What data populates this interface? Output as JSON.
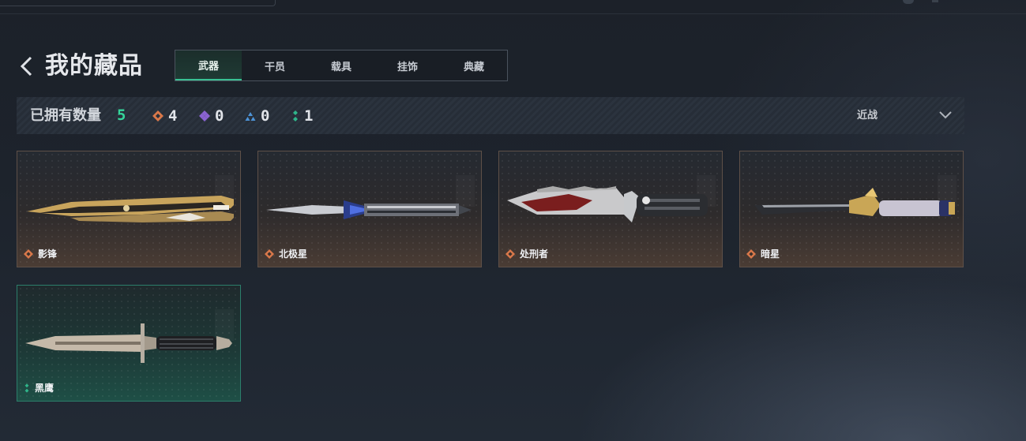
{
  "page": {
    "title": "我的藏品"
  },
  "tabs": [
    {
      "label": "武器",
      "active": true
    },
    {
      "label": "干员",
      "active": false
    },
    {
      "label": "载具",
      "active": false
    },
    {
      "label": "挂饰",
      "active": false
    },
    {
      "label": "典藏",
      "active": false
    }
  ],
  "stats": {
    "label": "已拥有数量",
    "total": "5",
    "rarity_counts": [
      {
        "icon": "orange-diamond-icon",
        "color": "#d9784a",
        "count": "4"
      },
      {
        "icon": "purple-diamond-icon",
        "color": "#8a63d2",
        "count": "0"
      },
      {
        "icon": "blue-triangle-icon",
        "color": "#4d94d8",
        "count": "0"
      },
      {
        "icon": "green-dots-icon",
        "color": "#2fb58a",
        "count": "1"
      }
    ]
  },
  "filter": {
    "value": "近战"
  },
  "items": [
    {
      "name": "影锋",
      "rarity": "orange",
      "rarity_icon": "orange-diamond-icon"
    },
    {
      "name": "北极星",
      "rarity": "orange",
      "rarity_icon": "orange-diamond-icon"
    },
    {
      "name": "处刑者",
      "rarity": "orange",
      "rarity_icon": "orange-diamond-icon"
    },
    {
      "name": "暗星",
      "rarity": "orange",
      "rarity_icon": "orange-diamond-icon"
    },
    {
      "name": "黑鹰",
      "rarity": "green",
      "rarity_icon": "green-dots-icon"
    }
  ],
  "colors": {
    "accent_green": "#35d49a",
    "orange_rarity": "#d9784a",
    "green_rarity": "#2fb58a"
  }
}
